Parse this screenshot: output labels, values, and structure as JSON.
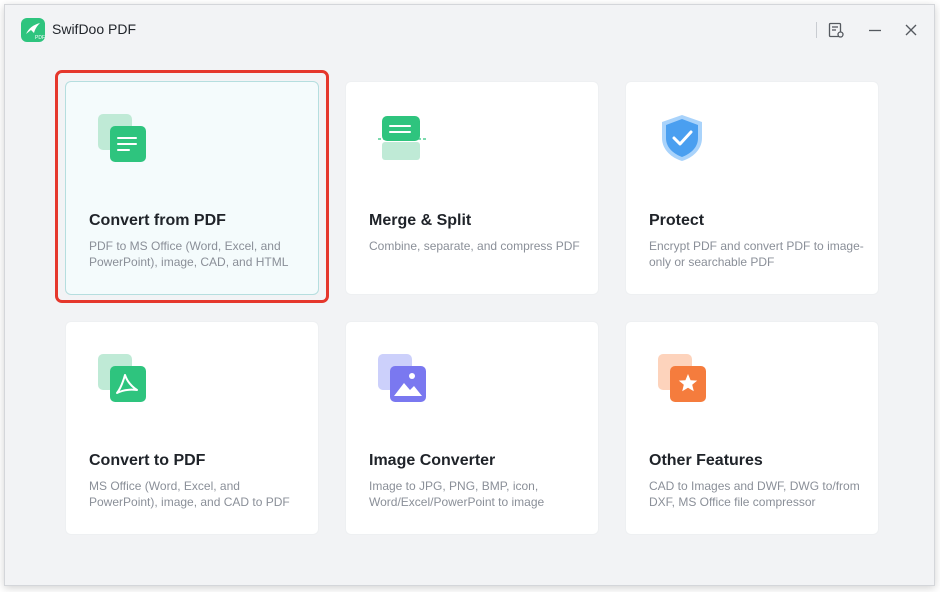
{
  "app": {
    "title": "SwifDoo PDF",
    "logo_label": "PDF"
  },
  "titlebar": {
    "icons": [
      "notes-icon",
      "minimize-icon",
      "close-icon"
    ]
  },
  "cards": [
    {
      "title": "Convert from PDF",
      "desc": "PDF to MS Office (Word, Excel, and PowerPoint), image, CAD, and HTML",
      "icon": "convert-from-pdf-icon",
      "selected": true
    },
    {
      "title": "Merge & Split",
      "desc": "Combine, separate, and compress PDF",
      "icon": "merge-split-icon"
    },
    {
      "title": "Protect",
      "desc": "Encrypt PDF and convert PDF to image-only or searchable PDF",
      "icon": "shield-check-icon"
    },
    {
      "title": "Convert to PDF",
      "desc": "MS Office (Word, Excel, and PowerPoint), image, and CAD to PDF",
      "icon": "convert-to-pdf-icon"
    },
    {
      "title": "Image Converter",
      "desc": "Image to JPG, PNG, BMP, icon, Word/Excel/PowerPoint to image",
      "icon": "image-converter-icon"
    },
    {
      "title": "Other Features",
      "desc": "CAD to Images and DWF, DWG to/from DXF, MS Office file compressor",
      "icon": "star-icon"
    }
  ],
  "colors": {
    "accent_green": "#2ec47e",
    "highlight_red": "#e5372c",
    "shield_blue": "#4a9ff0",
    "image_purple": "#7a78f0",
    "star_orange": "#f57c3d"
  }
}
